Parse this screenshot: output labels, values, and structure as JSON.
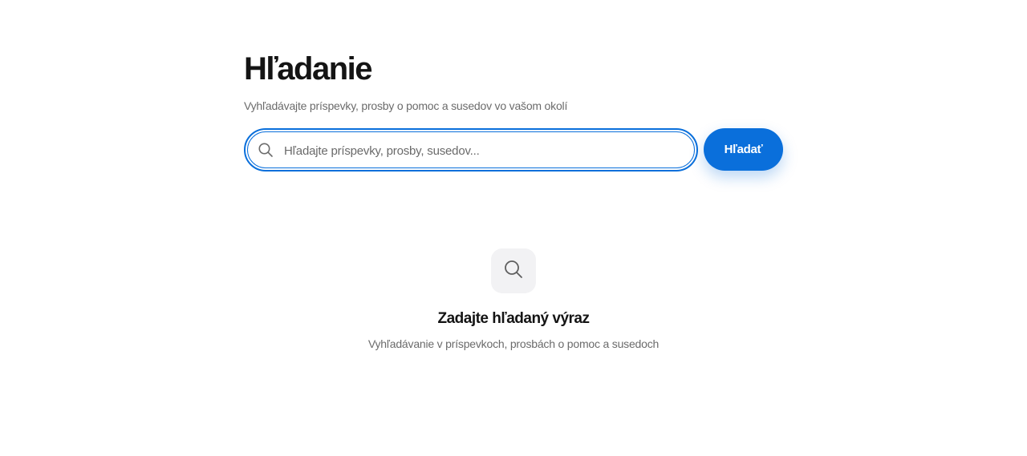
{
  "header": {
    "title": "Hľadanie",
    "subtitle": "Vyhľadávajte príspevky, prosby o pomoc a susedov vo vašom okolí"
  },
  "search": {
    "value": "",
    "placeholder": "Hľadajte príspevky, prosby, susedov...",
    "button_label": "Hľadať",
    "icon": "search-icon"
  },
  "empty_state": {
    "icon": "search-icon",
    "title": "Zadajte hľadaný výraz",
    "subtitle": "Vyhľadávanie v príspevkoch, prosbách o pomoc a susedoch"
  },
  "colors": {
    "accent": "#0a6fdb",
    "text": "#141414",
    "muted": "#6b6b6b",
    "icon_bg": "#f2f2f4"
  }
}
